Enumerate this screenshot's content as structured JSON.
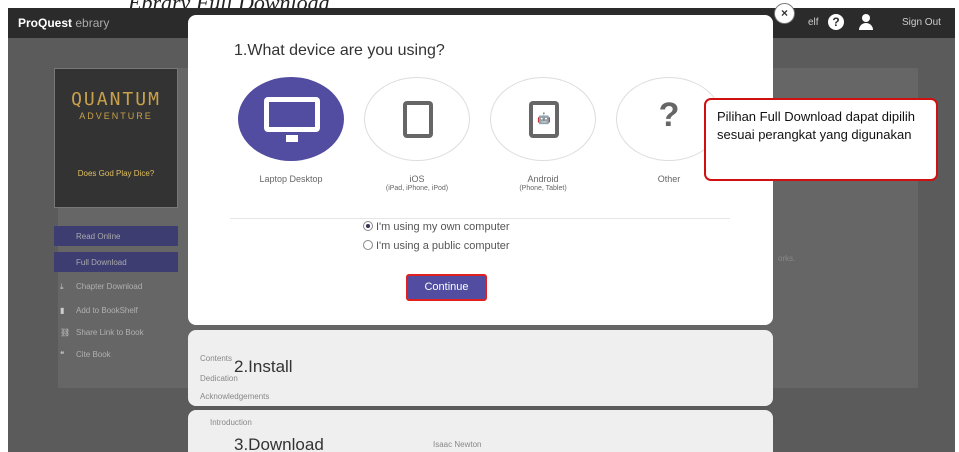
{
  "doc_caption": "Ebrary Full Download",
  "topbar": {
    "brand_main": "ProQuest",
    "brand_sub": "ebrary",
    "shelf_link": "elf",
    "sign_out": "Sign Out",
    "help_icon_glyph": "?"
  },
  "book": {
    "title": "QUANTUM",
    "subtitle": "ADVENTURE",
    "tagline": "Does God Play Dice?"
  },
  "sidebar": {
    "read_online": "Read Online",
    "full_download": "Full Download",
    "links": [
      {
        "icon": "chapter-download-icon",
        "glyph": "⤓",
        "label": "Chapter Download"
      },
      {
        "icon": "bookshelf-add-icon",
        "glyph": "▮",
        "label": "Add to BookShelf"
      },
      {
        "icon": "share-link-icon",
        "glyph": "⛓",
        "label": "Share Link to Book"
      },
      {
        "icon": "cite-icon",
        "glyph": "❝",
        "label": "Cite Book"
      }
    ]
  },
  "background_text": {
    "works": "orks.",
    "contents": "Contents",
    "dedication": "Dedication",
    "acknowledgements": "Acknowledgements",
    "introduction": "Introduction",
    "newton": "Isaac Newton"
  },
  "modal": {
    "close_glyph": "×",
    "question": "1.What device are you using?",
    "devices": [
      {
        "name": "Laptop Desktop",
        "detail": "",
        "active": true,
        "icon": "monitor-icon"
      },
      {
        "name": "iOS",
        "detail": "(iPad, iPhone, iPod)",
        "active": false,
        "icon": "apple-tablet-icon",
        "glyph": ""
      },
      {
        "name": "Android",
        "detail": "(Phone, Tablet)",
        "active": false,
        "icon": "android-tablet-icon",
        "glyph": "🤖"
      },
      {
        "name": "Other",
        "detail": "",
        "active": false,
        "icon": "question-icon",
        "glyph": "?"
      }
    ],
    "radio_own": "I'm using my own computer",
    "radio_public": "I'm using a public computer",
    "selected_radio": "own",
    "continue_label": "Continue"
  },
  "steps": {
    "install": "2.Install",
    "download": "3.Download"
  },
  "callout": "Pilihan Full Download dapat dipilih sesuai perangkat yang digunakan",
  "colors": {
    "accent": "#524da0",
    "highlight_border": "#e02020",
    "topbar": "#2b2b2b",
    "overlay": "#5b5b5b"
  }
}
